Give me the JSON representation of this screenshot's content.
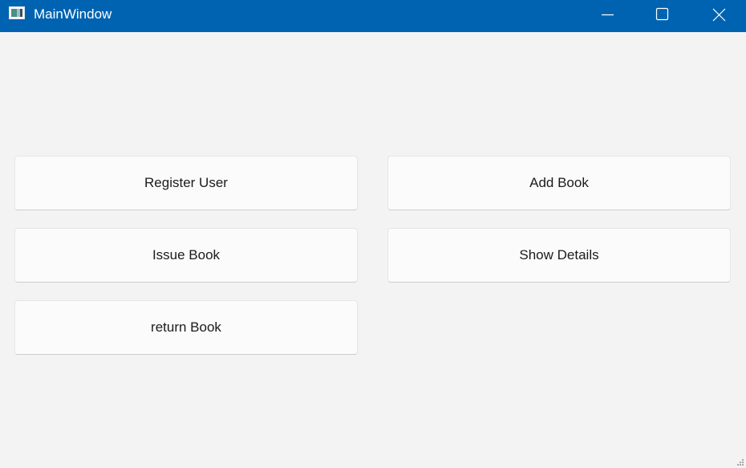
{
  "window": {
    "title": "MainWindow",
    "icon": "app-window-icon",
    "controls": {
      "minimize_icon": "minimize-icon",
      "maximize_icon": "maximize-icon",
      "close_icon": "close-icon"
    }
  },
  "buttons": {
    "register_user": "Register User",
    "add_book": "Add Book",
    "issue_book": "Issue Book",
    "show_details": "Show Details",
    "return_book": "return Book"
  },
  "colors": {
    "titlebar": "#0063b1",
    "background": "#f3f3f3",
    "button_face": "#fbfbfb",
    "button_text": "#1b1b1b"
  }
}
